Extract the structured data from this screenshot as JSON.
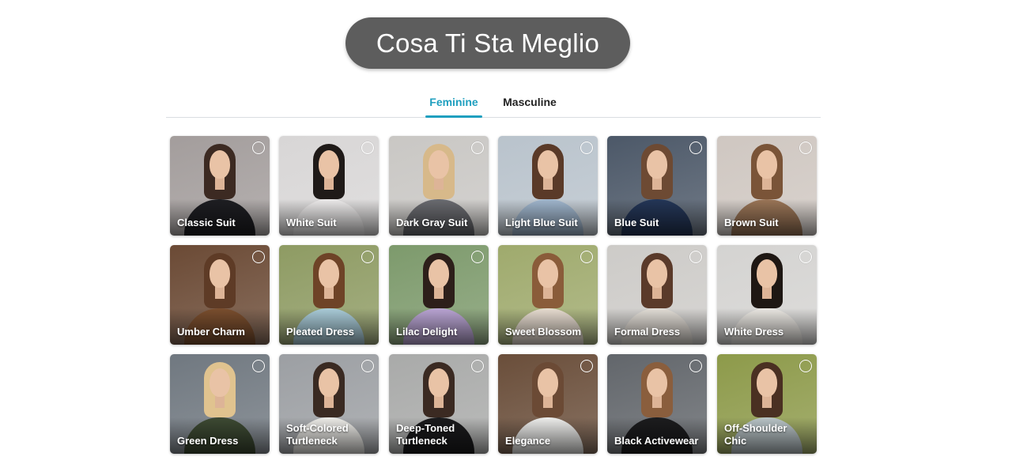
{
  "header": {
    "title": "Cosa Ti Sta Meglio"
  },
  "tabs": [
    {
      "label": "Feminine",
      "active": true
    },
    {
      "label": "Masculine",
      "active": false
    }
  ],
  "colors": {
    "accent": "#1f9fbf",
    "title_pill": "#5d5d5d"
  },
  "styles": [
    {
      "label": "Classic Suit",
      "bg": "#a39d9c",
      "outfit": "#1e1e22",
      "hair": "#3c2a22"
    },
    {
      "label": "White Suit",
      "bg": "#d8d6d6",
      "outfit": "#eceaea",
      "hair": "#1f1a18"
    },
    {
      "label": "Dark Gray Suit",
      "bg": "#c9c7c4",
      "outfit": "#6a6b70",
      "hair": "#d7b98a"
    },
    {
      "label": "Light Blue Suit",
      "bg": "#b9c3cc",
      "outfit": "#9fb5cc",
      "hair": "#5a3a28"
    },
    {
      "label": "Blue Suit",
      "bg": "#4c5868",
      "outfit": "#243657",
      "hair": "#6d4a33"
    },
    {
      "label": "Brown Suit",
      "bg": "#cfc7c1",
      "outfit": "#9a7557",
      "hair": "#7a5438"
    },
    {
      "label": "Umber Charm",
      "bg": "#6b4a35",
      "outfit": "#7a4e2e",
      "hair": "#5e3b26"
    },
    {
      "label": "Pleated Dress",
      "bg": "#8e9b63",
      "outfit": "#a9cbd8",
      "hair": "#6e4327"
    },
    {
      "label": "Lilac Delight",
      "bg": "#7d9a6c",
      "outfit": "#b9a4d3",
      "hair": "#2d1f1a"
    },
    {
      "label": "Sweet Blossom",
      "bg": "#9faa6d",
      "outfit": "#e7dcd0",
      "hair": "#8a5c3a"
    },
    {
      "label": "Formal Dress",
      "bg": "#cdcbc8",
      "outfit": "#e2ddd6",
      "hair": "#5a3a2a"
    },
    {
      "label": "White Dress",
      "bg": "#d4d3d1",
      "outfit": "#eae7e2",
      "hair": "#1e1713"
    },
    {
      "label": "Green Dress",
      "bg": "#707880",
      "outfit": "#3d4a33",
      "hair": "#e0c38f"
    },
    {
      "label": "Soft-Colored Turtleneck",
      "bg": "#9c9fa3",
      "outfit": "#ecebe7",
      "hair": "#3a2a22"
    },
    {
      "label": "Deep-Toned Turtleneck",
      "bg": "#a9aaa9",
      "outfit": "#1b1b1d",
      "hair": "#3b2a22"
    },
    {
      "label": "Elegance",
      "bg": "#6a4e3a",
      "outfit": "#ededeb",
      "hair": "#6b4a35"
    },
    {
      "label": "Black Activewear",
      "bg": "#62666b",
      "outfit": "#1c1c1e",
      "hair": "#8a5e3d"
    },
    {
      "label": "Off-Shoulder Chic",
      "bg": "#8d9a4a",
      "outfit": "#b8c3c6",
      "hair": "#4a3022"
    }
  ]
}
